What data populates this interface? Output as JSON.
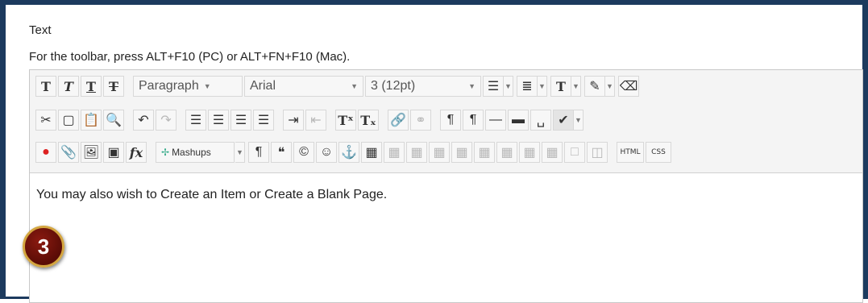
{
  "field": {
    "label": "Text",
    "toolbar_hint": "For the toolbar, press ALT+F10 (PC) or ALT+FN+F10 (Mac)."
  },
  "toolbar": {
    "row1": {
      "bold": "T",
      "italic": "T",
      "underline": "T",
      "strikethrough": "T",
      "format_select": "Paragraph",
      "font_select": "Arial",
      "size_select": "3 (12pt)",
      "text_color": "T"
    },
    "row2": {
      "superscript": "Tˣ",
      "subscript": "Tₓ"
    },
    "row3": {
      "formula": "fx",
      "mashups": "Mashups",
      "html": "HTML",
      "css": "CSS"
    }
  },
  "content": {
    "text": "You may also wish to Create an Item or Create a Blank Page."
  },
  "annotation": {
    "step_number": "3"
  },
  "colors": {
    "frame": "#1c3a5e",
    "badge": "#7a150c",
    "badge_ring": "#d4a640"
  }
}
